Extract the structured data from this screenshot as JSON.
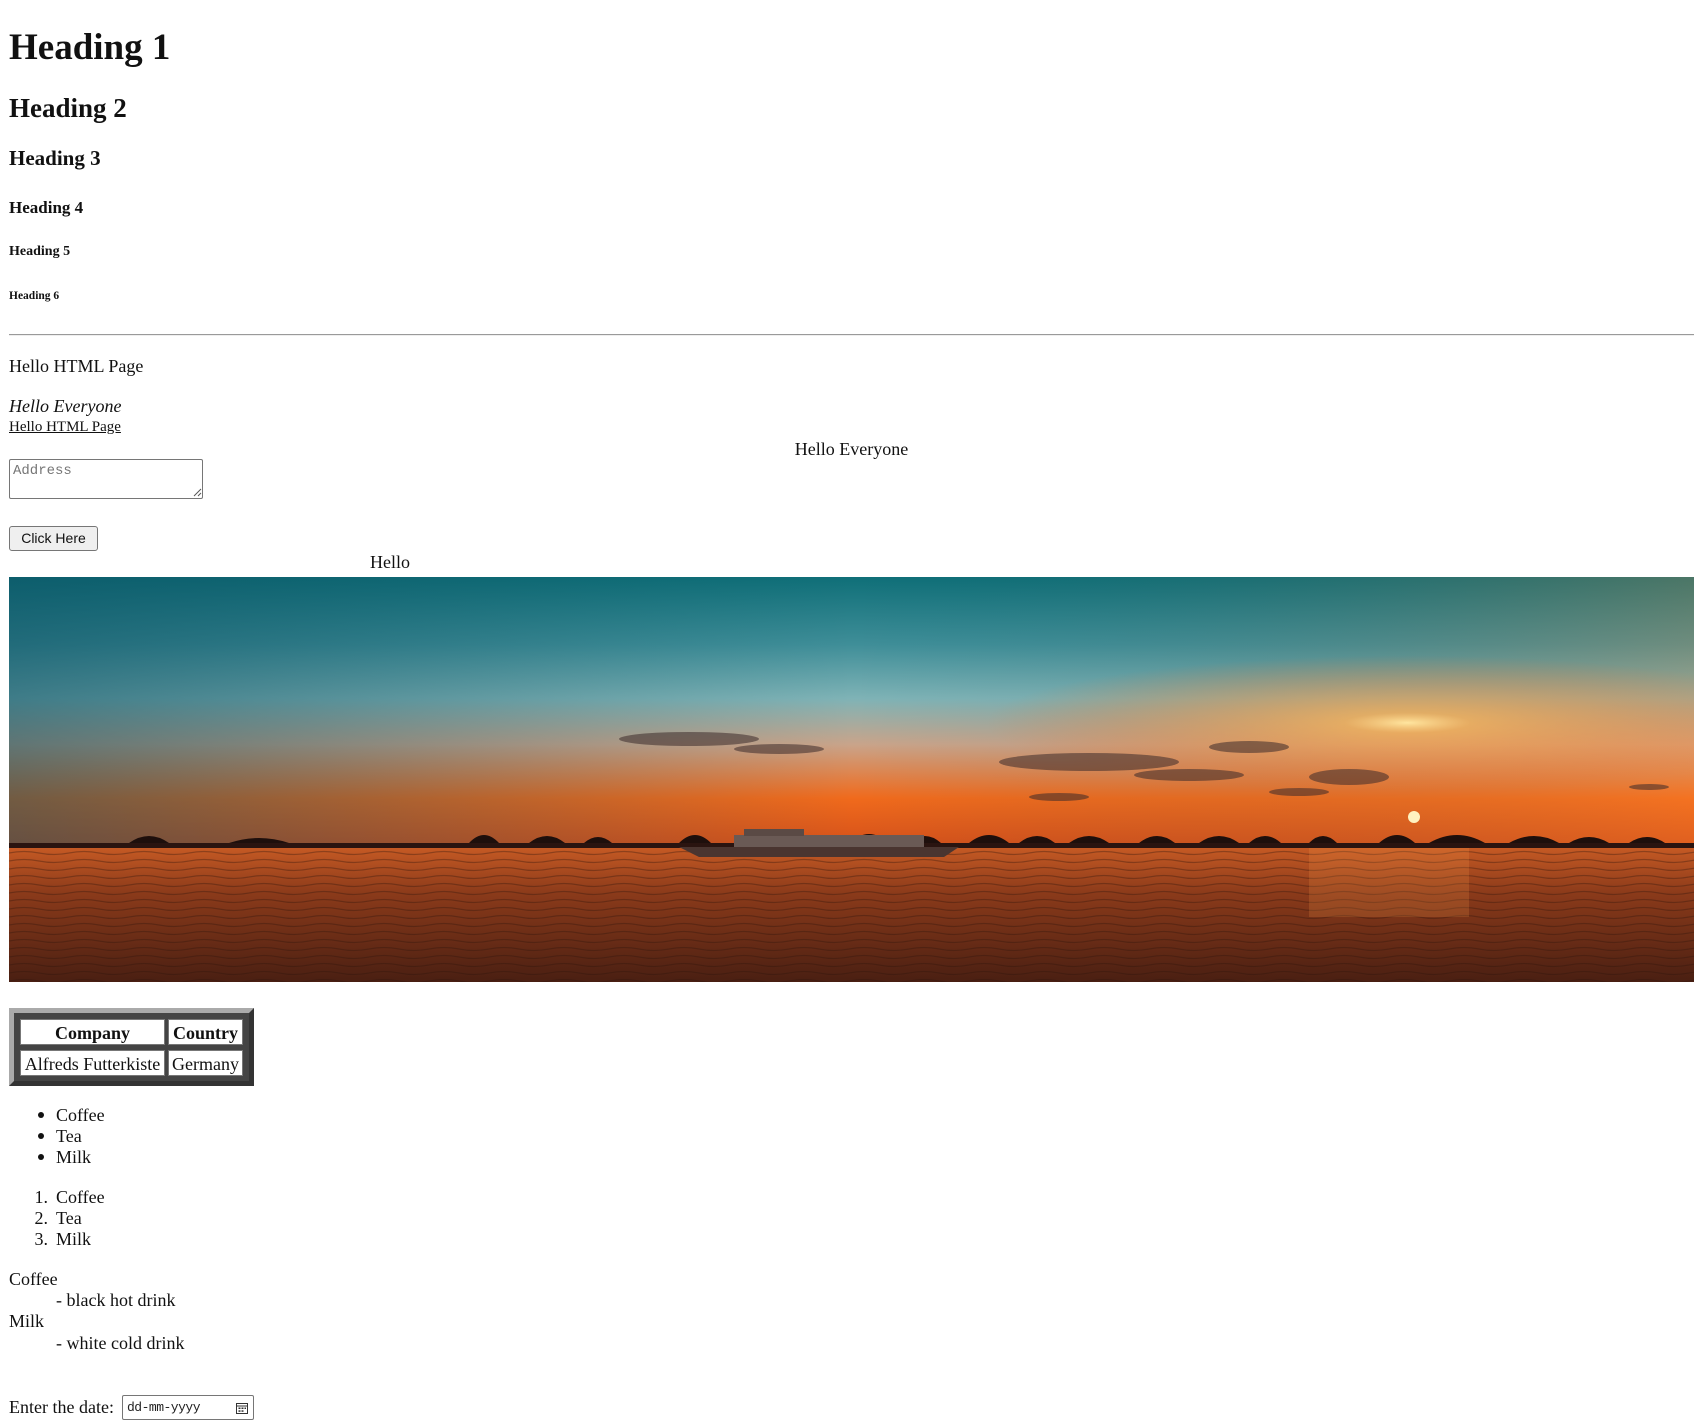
{
  "headings": {
    "h1": "Heading 1",
    "h2": "Heading 2",
    "h3": "Heading 3",
    "h4": "Heading 4",
    "h5": "Heading 5",
    "h6": "Heading 6"
  },
  "paragraph": "Hello HTML Page",
  "italic_text": "Hello Everyone",
  "link_text": "Hello HTML Page",
  "centered_text": "Hello Everyone",
  "textarea": {
    "placeholder": "Address",
    "value": ""
  },
  "button_label": "Click Here",
  "hello_text": "Hello",
  "table": {
    "headers": [
      "Company",
      "Country"
    ],
    "rows": [
      [
        "Alfreds Futterkiste",
        "Germany"
      ]
    ]
  },
  "unordered_list": [
    "Coffee",
    "Tea",
    "Milk"
  ],
  "ordered_list": [
    "Coffee",
    "Tea",
    "Milk"
  ],
  "description_list": [
    {
      "term": "Coffee",
      "definition": "- black hot drink"
    },
    {
      "term": "Milk",
      "definition": "- white cold drink"
    }
  ],
  "date_field": {
    "label": "Enter the date:",
    "placeholder": "dd-mm-yyyy",
    "icon": "calendar-icon"
  },
  "image": {
    "subject": "sunset-over-sea-with-boat",
    "colors": {
      "sky_top": "#0f6f78",
      "sky_mid": "#7fb3b6",
      "horizon": "#f06a1c",
      "sun": "#ffe6a0",
      "water": "#8a3a1a"
    }
  }
}
